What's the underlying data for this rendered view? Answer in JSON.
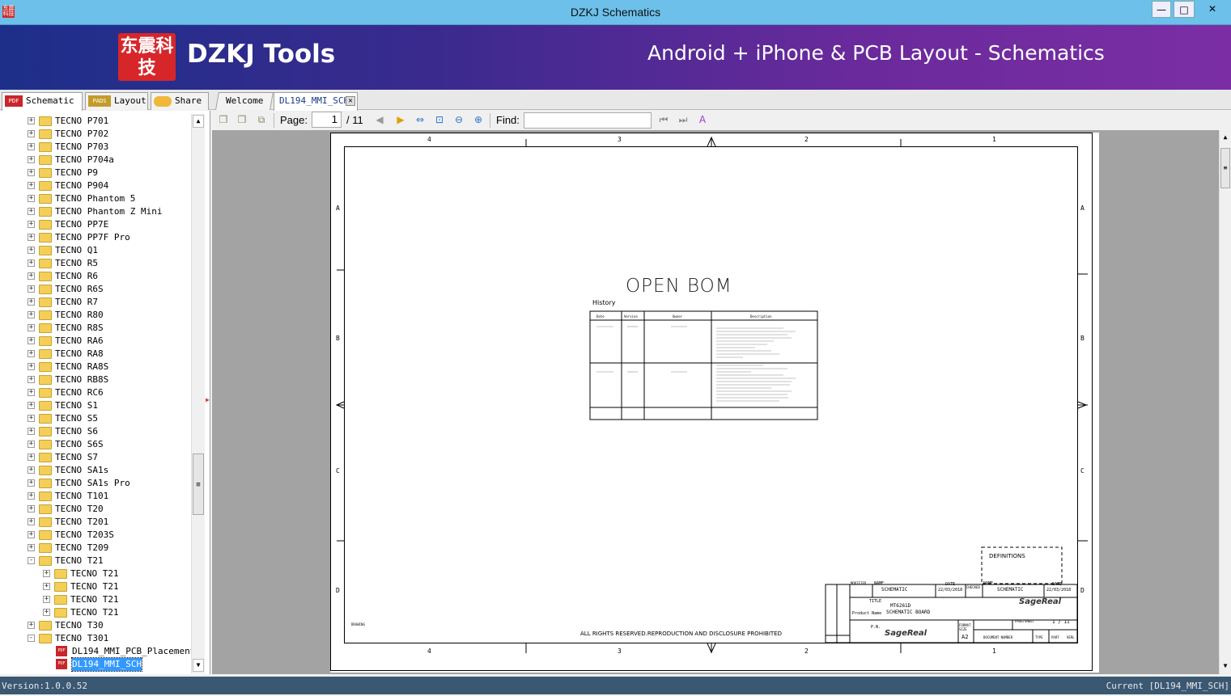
{
  "window": {
    "title": "DZKJ Schematics",
    "minimize": "—",
    "maximize": "□",
    "close": "✕",
    "app_icon_text": "东震科技"
  },
  "banner": {
    "logo_text": "东震科技",
    "brand": "DZKJ Tools",
    "slogan": "Android + iPhone & PCB Layout - Schematics"
  },
  "tabs": {
    "schematic": "Schematic",
    "layout": "Layout",
    "share": "Share",
    "doc_welcome": "Welcome",
    "doc_current": "DL194_MMI_SCH",
    "pdf_badge": "PDF",
    "pads_badge": "PADS"
  },
  "tree": {
    "items": [
      {
        "label": "TECNO P701",
        "level": 1,
        "expander": "+"
      },
      {
        "label": "TECNO P702",
        "level": 1,
        "expander": "+"
      },
      {
        "label": "TECNO P703",
        "level": 1,
        "expander": "+"
      },
      {
        "label": "TECNO P704a",
        "level": 1,
        "expander": "+"
      },
      {
        "label": "TECNO P9",
        "level": 1,
        "expander": "+"
      },
      {
        "label": "TECNO P904",
        "level": 1,
        "expander": "+"
      },
      {
        "label": "TECNO Phantom 5",
        "level": 1,
        "expander": "+"
      },
      {
        "label": "TECNO Phantom Z Mini",
        "level": 1,
        "expander": "+"
      },
      {
        "label": "TECNO PP7E",
        "level": 1,
        "expander": "+"
      },
      {
        "label": "TECNO PP7F Pro",
        "level": 1,
        "expander": "+"
      },
      {
        "label": "TECNO Q1",
        "level": 1,
        "expander": "+"
      },
      {
        "label": "TECNO R5",
        "level": 1,
        "expander": "+"
      },
      {
        "label": "TECNO R6",
        "level": 1,
        "expander": "+"
      },
      {
        "label": "TECNO R6S",
        "level": 1,
        "expander": "+"
      },
      {
        "label": "TECNO R7",
        "level": 1,
        "expander": "+"
      },
      {
        "label": "TECNO R80",
        "level": 1,
        "expander": "+"
      },
      {
        "label": "TECNO R8S",
        "level": 1,
        "expander": "+"
      },
      {
        "label": "TECNO RA6",
        "level": 1,
        "expander": "+"
      },
      {
        "label": "TECNO RA8",
        "level": 1,
        "expander": "+"
      },
      {
        "label": "TECNO RA8S",
        "level": 1,
        "expander": "+"
      },
      {
        "label": "TECNO RB8S",
        "level": 1,
        "expander": "+"
      },
      {
        "label": "TECNO RC6",
        "level": 1,
        "expander": "+"
      },
      {
        "label": "TECNO S1",
        "level": 1,
        "expander": "+"
      },
      {
        "label": "TECNO S5",
        "level": 1,
        "expander": "+"
      },
      {
        "label": "TECNO S6",
        "level": 1,
        "expander": "+"
      },
      {
        "label": "TECNO S6S",
        "level": 1,
        "expander": "+"
      },
      {
        "label": "TECNO S7",
        "level": 1,
        "expander": "+"
      },
      {
        "label": "TECNO SA1s",
        "level": 1,
        "expander": "+"
      },
      {
        "label": "TECNO SA1s Pro",
        "level": 1,
        "expander": "+"
      },
      {
        "label": "TECNO T101",
        "level": 1,
        "expander": "+"
      },
      {
        "label": "TECNO T20",
        "level": 1,
        "expander": "+"
      },
      {
        "label": "TECNO T201",
        "level": 1,
        "expander": "+"
      },
      {
        "label": "TECNO T203S",
        "level": 1,
        "expander": "+"
      },
      {
        "label": "TECNO T209",
        "level": 1,
        "expander": "+"
      },
      {
        "label": "TECNO T21",
        "level": 1,
        "expander": "-"
      },
      {
        "label": "TECNO T21",
        "level": 2,
        "expander": "+"
      },
      {
        "label": "TECNO T21",
        "level": 2,
        "expander": "+"
      },
      {
        "label": "TECNO T21",
        "level": 2,
        "expander": "+"
      },
      {
        "label": "TECNO T21",
        "level": 2,
        "expander": "+"
      },
      {
        "label": "TECNO T30",
        "level": 1,
        "expander": "+"
      },
      {
        "label": "TECNO T301",
        "level": 1,
        "expander": "-"
      },
      {
        "label": "DL194_MMI_PCB_Placement",
        "level": 2,
        "type": "pdf"
      },
      {
        "label": "DL194_MMI_SCH",
        "level": 2,
        "type": "pdf",
        "selected": true
      }
    ]
  },
  "toolbar": {
    "page_label": "Page:",
    "page_current": "1",
    "page_total": "/ 11",
    "find_label": "Find:",
    "find_value": ""
  },
  "sheet": {
    "heading": "OPEN BOM",
    "history_label": "History",
    "col_headers": [
      "Date",
      "Version",
      "Owner",
      "Description"
    ],
    "zone_cols_top": [
      "4",
      "3",
      "2",
      "1"
    ],
    "zone_rows": [
      "A",
      "B",
      "C",
      "D"
    ],
    "footer_notice": "ALL RIGHTS RESERVED.REPRODUCTION AND DISCLOSURE PROHIBITED",
    "definitions": "DEFINITIONS",
    "tb_name": "NAME",
    "tb_schematic": "SCHEMATIC",
    "tb_date": "DATE",
    "tb_date_val": "22/03/2018",
    "tb_checked": "CHECKED",
    "tb_title": "TITLE",
    "tb_title_val": "MT6261D",
    "tb_product": "Product Name",
    "tb_board": "SCHEMATIC BOARD",
    "tb_pn": "P.N.",
    "tb_format": "FORMAT SIZE",
    "tb_size": "A2",
    "tb_docnum": "DOCUMENT NUMBER",
    "tb_type": "TYPE",
    "tb_part": "PART",
    "tb_verl": "VERL",
    "tb_page": "PAGE/SHEET",
    "tb_pageval": "1 / 11",
    "tb_modified": "MODIFIED",
    "brand": "SageReal",
    "drawing": "DRAWING"
  },
  "status": {
    "version": "Version:1.0.0.52",
    "current": "Current [DL194_MMI_SCH]"
  }
}
